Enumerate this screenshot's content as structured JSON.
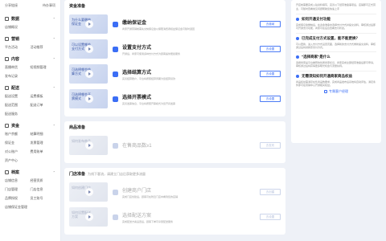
{
  "sidebar": {
    "top": [
      "分享链接",
      "待办事项"
    ],
    "sections": [
      {
        "title": "数据",
        "items": [
          "店铺概况"
        ]
      },
      {
        "title": "营销",
        "items": [
          "平台活动",
          "活动推荐"
        ]
      },
      {
        "title": "内容",
        "items": [
          "直播带货",
          "短视频管理",
          "发布记录"
        ]
      },
      {
        "title": "配送",
        "items": [
          "配送设置",
          "运费模板",
          "配送范围",
          "配送订单",
          "配送服务"
        ]
      },
      {
        "title": "资金",
        "items": [
          "账户余额",
          "结算明细",
          "保证金",
          "发票管理",
          "对公账户",
          "费用账单",
          "资产中心"
        ]
      },
      {
        "title": "档案",
        "items": [
          "店铺信息",
          "经营资质",
          "门店管理",
          "门店信息",
          "品牌授权",
          "员工账号",
          "店铺保证金管理"
        ]
      }
    ]
  },
  "cards": [
    {
      "title": "资金准备",
      "sub": "",
      "rows": [
        {
          "thumb": "为什么要缴纳保证金",
          "title": "缴纳保证金",
          "desc": "商家开通营销前需先交纳保证金以保障消费者权益保证金可随时退回",
          "btn": "去缴纳",
          "dim": false
        },
        {
          "thumb": "可以设置哪些支付方式",
          "title": "设置支付方式",
          "desc": "开通后，商家可使用多种支付方式为顾客提供便捷服务",
          "btn": "去设置",
          "dim": false
        },
        {
          "thumb": "可选择哪些结算方式",
          "title": "选择结算方式",
          "desc": "完善结算账户，平台将按照结算周期为您结算货款",
          "btn": "去设置",
          "dim": false
        },
        {
          "thumb": "可选择哪些开票模式",
          "title": "选择开票模式",
          "desc": "完善发票信息，平台将按照开票模式为您开具发票",
          "btn": "去设置",
          "dim": false
        }
      ]
    },
    {
      "title": "商品准备",
      "sub": "",
      "rows": [
        {
          "thumb": "如何发布商品",
          "title": "在售商品数≥1",
          "desc": "",
          "btn": "去发布",
          "dim": true
        }
      ]
    },
    {
      "title": "门店准备",
      "sub": "为线下客流，请建立门店后获取更多流量",
      "rows": [
        {
          "thumb": "如何创建门店",
          "title": "创建商户门店",
          "desc": "完成门店创建后，顾客可在附近门店中看到您的店铺",
          "btn": "去创建",
          "dim": true
        },
        {
          "thumb": "如何设置配送方案",
          "title": "选择配送方案",
          "desc": "完成配送方案设置后，顾客下单可享受配送服务",
          "btn": "去设置",
          "dim": true
        }
      ]
    }
  ],
  "right": {
    "intro": "开店前需要完成入驻资料填写，完善以下经营准备事项后，店铺即可正式营业，可随时查看常见问题帮助您快速上手",
    "faqs": [
      {
        "q": "如何开通支付功能",
        "a": "完成保证金缴纳后，在资金准备中选择支付方式并提交资料，审核通过后即可开通支付功能，商家可在后台查看支付状态。"
      },
      {
        "q": "已完成支付方式设置，能不能更换？",
        "a": "可以更换，进入支付方式设置页面，选择新的支付方式重新提交资料，审核通过后将替换原支付方式。"
      },
      {
        "q": "\"选择商家\"是什么",
        "a": "选择商家是平台推荐的优质商家标识，商家完成全部经营准备后即可申请，审核通过后将获得更多曝光机会与流量扶持。"
      },
      {
        "q": "无需须知如何开通商家商品权益",
        "a": "商品权益需满足在售商品数要求，完成商品发布后系统将自动评估，满足条件即可在营销中心开通相关权益。"
      }
    ],
    "footer": "专属客户经理"
  }
}
